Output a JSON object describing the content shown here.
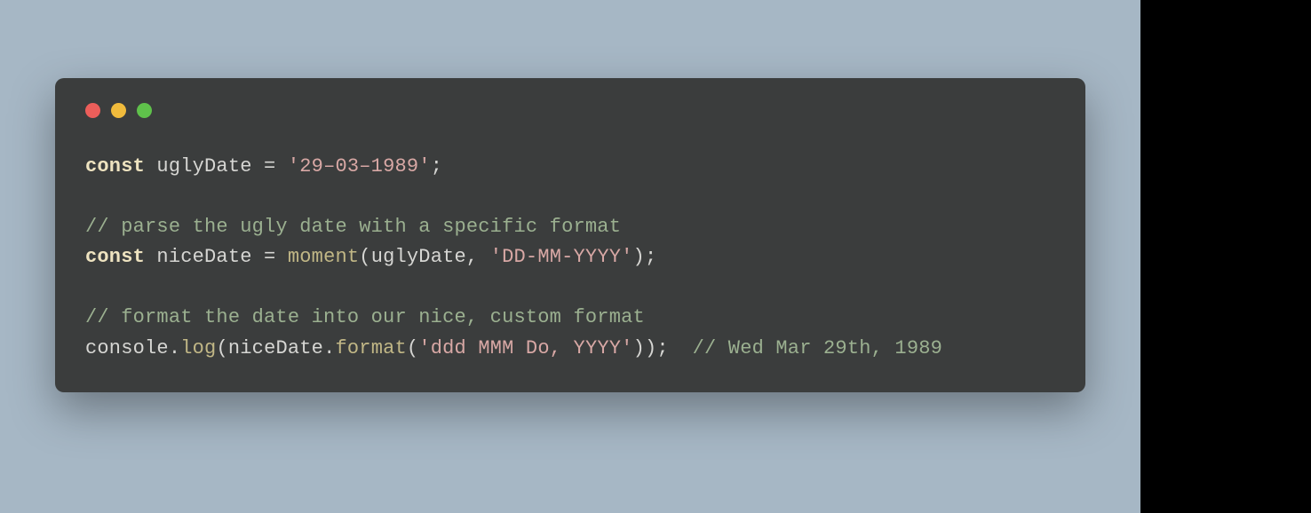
{
  "code": {
    "line1": {
      "keyword": "const",
      "ident": " uglyDate ",
      "op": "=",
      "sp": " ",
      "str": "'29–03–1989'",
      "semi": ";"
    },
    "line3": {
      "comment": "// parse the ugly date with a specific format"
    },
    "line4": {
      "keyword": "const",
      "ident": " niceDate ",
      "op": "=",
      "sp": " ",
      "fn": "moment",
      "lparen": "(",
      "arg1": "uglyDate",
      "comma": ", ",
      "str": "'DD-MM-YYYY'",
      "rparen": ")",
      "semi": ";"
    },
    "line6": {
      "comment": "// format the date into our nice, custom format"
    },
    "line7": {
      "obj": "console",
      "dot1": ".",
      "method1": "log",
      "lparen1": "(",
      "arg": "niceDate",
      "dot2": ".",
      "method2": "format",
      "lparen2": "(",
      "str": "'ddd MMM Do, YYYY'",
      "rparen2": ")",
      "rparen1": ")",
      "semi": ";",
      "gap": "  ",
      "comment": "// Wed Mar 29th, 1989"
    }
  },
  "colors": {
    "background_outer": "#a6b7c5",
    "background_window": "#3b3d3d",
    "traffic_red": "#ec5e5a",
    "traffic_yellow": "#f0bb3c",
    "traffic_green": "#5fc14b"
  }
}
